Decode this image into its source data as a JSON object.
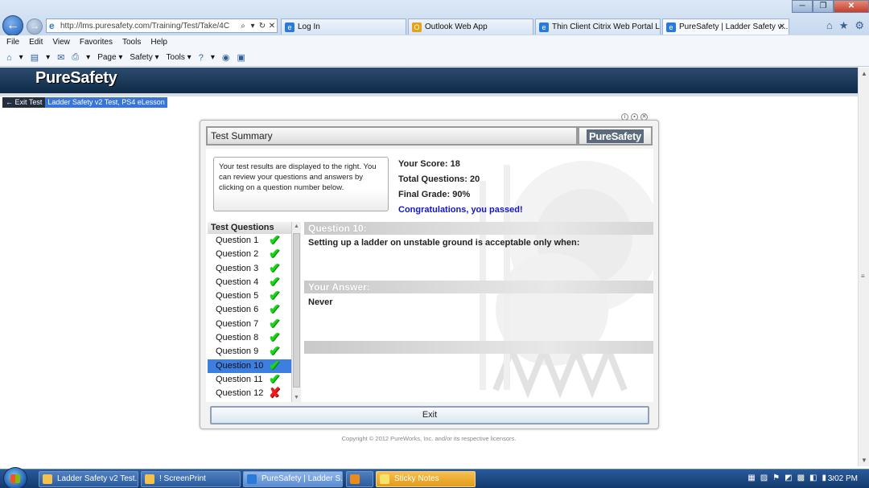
{
  "browser": {
    "url": "http://lms.puresafety.com/Training/Test/Take/4C",
    "tabs": [
      {
        "label": "Log In",
        "icon": "ie-tab-icon"
      },
      {
        "label": "Outlook Web App",
        "icon": "outlook-icon"
      },
      {
        "label": "Thin Client Citrix Web Portal L...",
        "icon": "ie-tab-icon"
      },
      {
        "label": "PureSafety | Ladder Safety v...",
        "icon": "ie-tab-icon"
      }
    ],
    "menu": [
      "File",
      "Edit",
      "View",
      "Favorites",
      "Tools",
      "Help"
    ],
    "commands": [
      "Page",
      "Safety",
      "Tools"
    ]
  },
  "page": {
    "logo": "PureSafety",
    "exit_test_label": "Exit Test",
    "course_title": "Ladder Safety v2 Test, PS4 eLesson",
    "copyright": "Copyright © 2012 PureWorks, Inc. and/or its respective licensors."
  },
  "dialog": {
    "title": "Test Summary",
    "logo": "PureSafety",
    "info_text": "Your test results are displayed to the right. You can review your questions and answers by clicking on a question number below.",
    "score": "Your Score: 18",
    "total_questions": "Total Questions: 20",
    "final_grade": "Final Grade: 90%",
    "congrats": "Congratulations, you passed!",
    "questions_header": "Test Questions",
    "questions": [
      {
        "label": "Question 1",
        "result": "correct"
      },
      {
        "label": "Question 2",
        "result": "correct"
      },
      {
        "label": "Question 3",
        "result": "correct"
      },
      {
        "label": "Question 4",
        "result": "correct"
      },
      {
        "label": "Question 5",
        "result": "correct"
      },
      {
        "label": "Question 6",
        "result": "correct"
      },
      {
        "label": "Question 7",
        "result": "correct"
      },
      {
        "label": "Question 8",
        "result": "correct"
      },
      {
        "label": "Question 9",
        "result": "correct"
      },
      {
        "label": "Question 10",
        "result": "correct"
      },
      {
        "label": "Question 11",
        "result": "correct"
      },
      {
        "label": "Question 12",
        "result": "wrong"
      }
    ],
    "selected_question": 10,
    "question_heading": "Question 10:",
    "question_text": "Setting up a ladder on unstable ground is acceptable only when:",
    "answer_heading": "Your Answer:",
    "answer_text": "Never",
    "exit_label": "Exit"
  },
  "taskbar": {
    "buttons": [
      {
        "label": "Ladder Safety v2 Test...",
        "icon": "folder-icon"
      },
      {
        "label": "! ScreenPrint",
        "icon": "folder-icon"
      },
      {
        "label": "PureSafety | Ladder S...",
        "icon": "ie-task-icon"
      },
      {
        "label": "",
        "icon": "media-player-icon"
      },
      {
        "label": "Sticky Notes",
        "icon": "sticky-notes-icon"
      }
    ],
    "clock": "3:02 PM"
  },
  "colors": {
    "header_bg": "#102a48",
    "selected_row": "#3d7fe0",
    "congrats_text": "#1515c8",
    "correct_mark": "#19d619",
    "wrong_mark": "#ee1c1c"
  }
}
